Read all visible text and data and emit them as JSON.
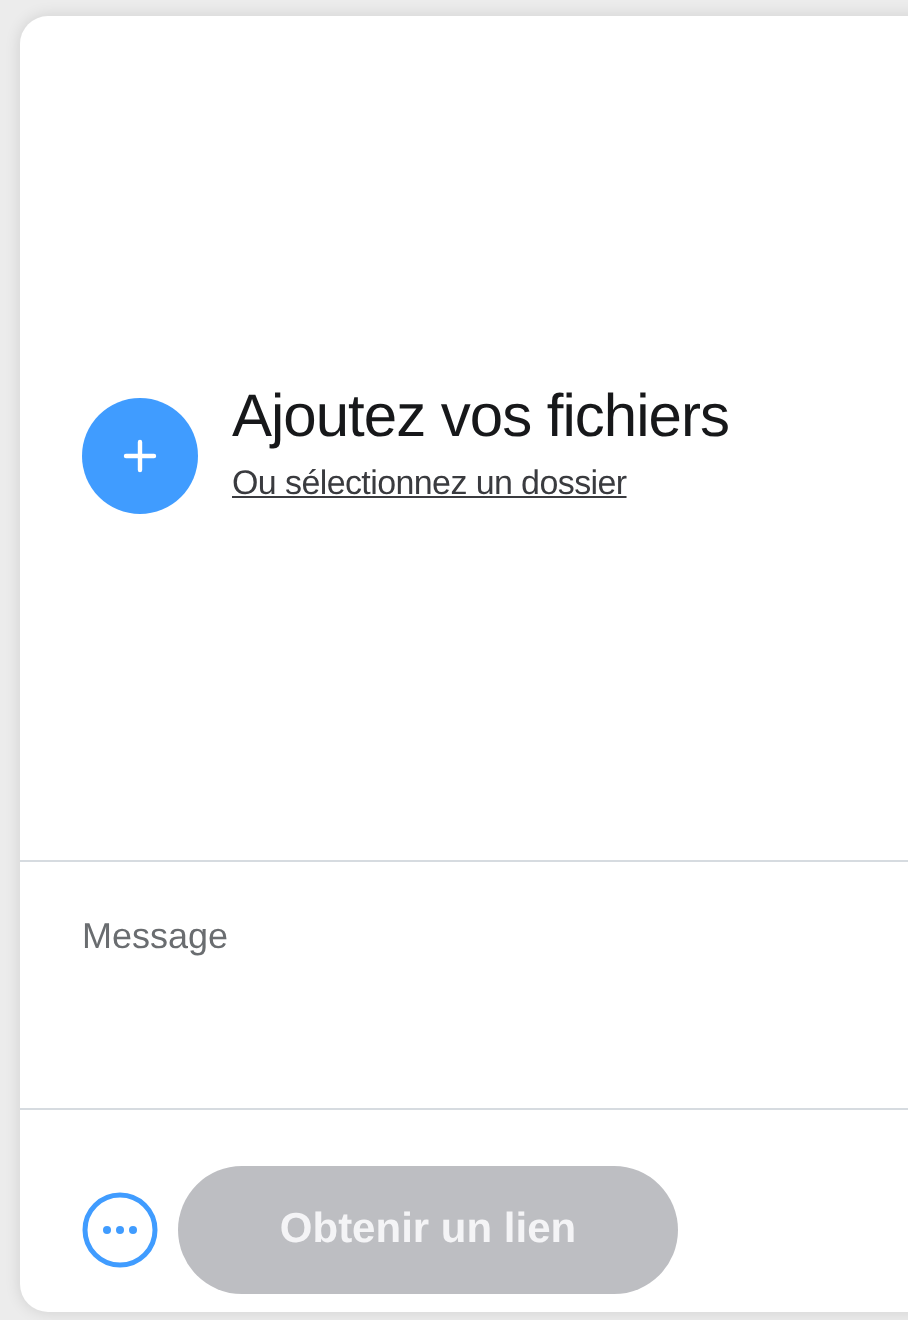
{
  "upload": {
    "title": "Ajoutez vos fichiers",
    "link": "Ou sélectionnez un dossier"
  },
  "message": {
    "placeholder": "Message"
  },
  "footer": {
    "button": {
      "label": "Obtenir un lien",
      "disabled": true
    }
  }
}
